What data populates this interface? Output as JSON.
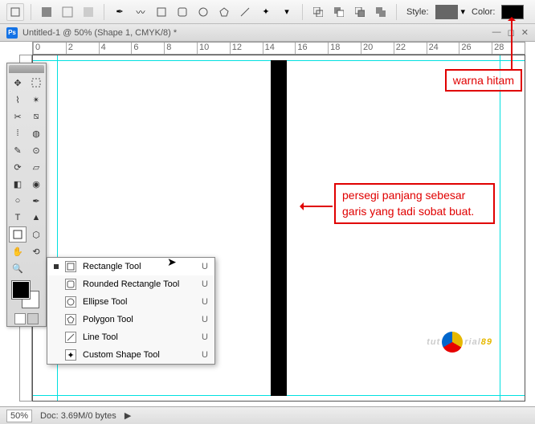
{
  "toolbar": {
    "style_label": "Style:",
    "color_label": "Color:",
    "style_swatch": "#666666",
    "color_swatch": "#000000"
  },
  "document": {
    "app_icon": "Ps",
    "title": "Untitled-1 @ 50% (Shape 1, CMYK/8) *"
  },
  "ruler_ticks": [
    "0",
    "2",
    "4",
    "6",
    "8",
    "10",
    "12",
    "14",
    "16",
    "18",
    "20",
    "22",
    "24",
    "26",
    "28"
  ],
  "flyout": {
    "items": [
      {
        "label": "Rectangle Tool",
        "shortcut": "U",
        "selected": true
      },
      {
        "label": "Rounded Rectangle Tool",
        "shortcut": "U",
        "selected": false
      },
      {
        "label": "Ellipse Tool",
        "shortcut": "U",
        "selected": false
      },
      {
        "label": "Polygon Tool",
        "shortcut": "U",
        "selected": false
      },
      {
        "label": "Line Tool",
        "shortcut": "U",
        "selected": false
      },
      {
        "label": "Custom Shape Tool",
        "shortcut": "U",
        "selected": false
      }
    ]
  },
  "status": {
    "zoom": "50%",
    "doc_info": "Doc: 3.69M/0 bytes",
    "arrow": "▶"
  },
  "annotations": {
    "a1": "warna hitam",
    "a2": "persegi panjang sebesar garis yang tadi sobat buat."
  },
  "watermark": {
    "pre": "tut",
    "post": "rial",
    "num": "89"
  }
}
